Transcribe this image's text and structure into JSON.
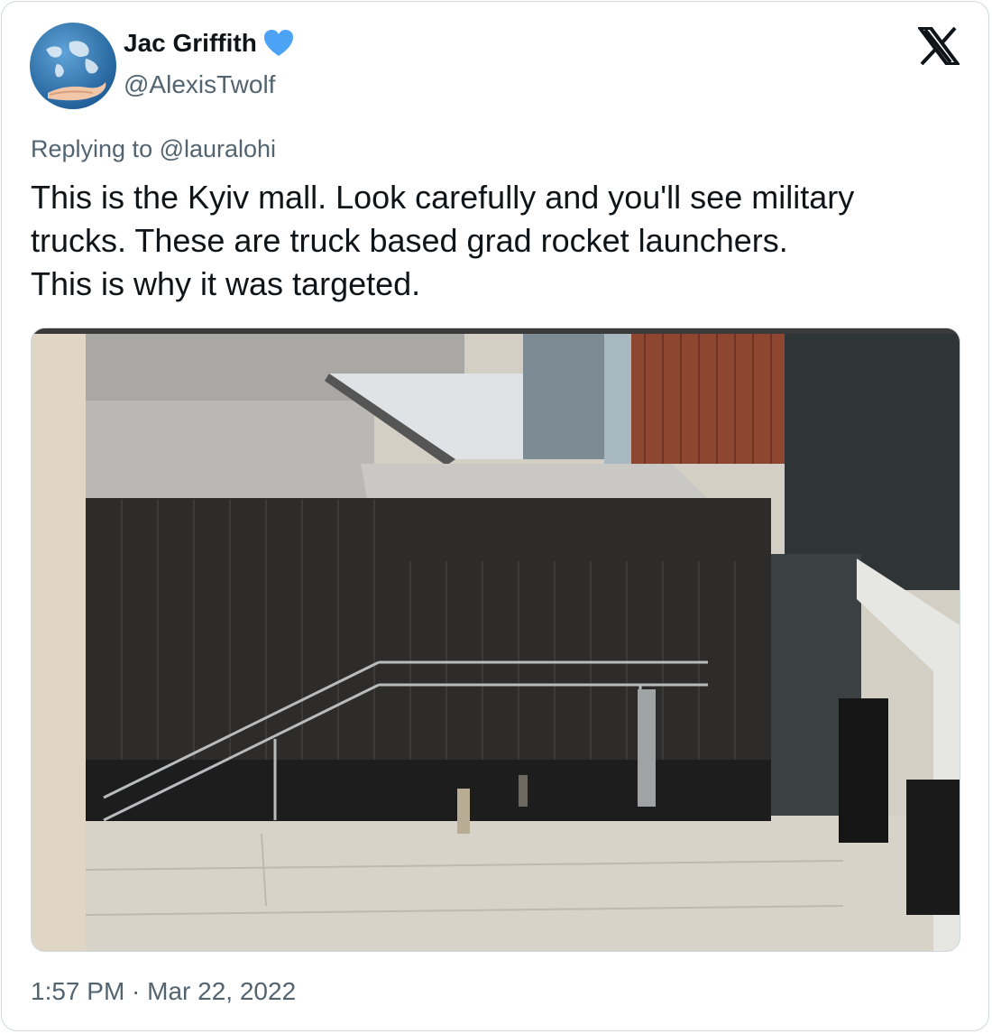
{
  "author": {
    "display_name": "Jac Griffith",
    "handle": "@AlexisTwolf",
    "verified": true
  },
  "reply_context": "Replying to @lauralohi",
  "tweet_text": "This is the Kyiv mall. Look carefully and you'll see military\ntrucks. These are truck based grad rocket launchers.\nThis is why it was targeted.",
  "timestamp": "1:57 PM · Mar 22, 2022",
  "icons": {
    "platform_logo": "x-logo-icon",
    "verified_badge": "verified-badge-icon"
  },
  "colors": {
    "verified_blue": "#4ca3f5",
    "text_primary": "#0f1419",
    "text_secondary": "#536471"
  }
}
